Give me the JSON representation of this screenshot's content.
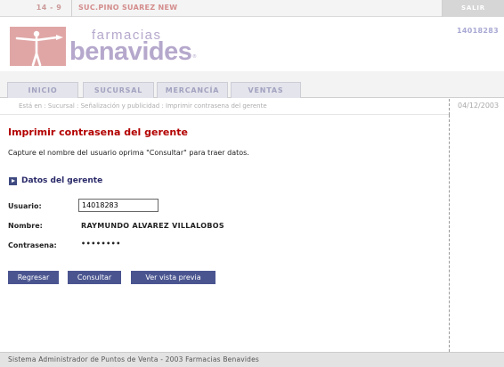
{
  "header": {
    "store_code": "14 - 9",
    "store_name": "SUC.PINO SUAREZ NEW",
    "exit_label": "SALIR",
    "user_code": "14018283"
  },
  "logo": {
    "line1": "farmacias",
    "line2": "benavides",
    "reg": "®"
  },
  "tabs": [
    {
      "label": "INICIO"
    },
    {
      "label": "SUCURSAL"
    },
    {
      "label": "MERCANCÍA"
    },
    {
      "label": "VENTAS"
    }
  ],
  "breadcrumb": "Está en : Sucursal : Señalización y publicidad : Imprimir contrasena del gerente",
  "date": "04/12/2003",
  "page": {
    "title": "Imprimir contrasena del gerente",
    "instructions": "Capture el nombre del usuario oprima \"Consultar\" para traer datos.",
    "section_title": "Datos del gerente"
  },
  "form": {
    "usuario_label": "Usuario:",
    "usuario_value": "14018283",
    "nombre_label": "Nombre:",
    "nombre_value": "RAYMUNDO ALVAREZ VILLALOBOS",
    "contrasena_label": "Contrasena:",
    "contrasena_value": "••••••••"
  },
  "buttons": {
    "back": "Regresar",
    "query": "Consultar",
    "preview": "Ver vista previa"
  },
  "footer": "Sistema Administrador de Puntos de Venta - 2003 Farmacias Benavides",
  "colors": {
    "title_red": "#b30000",
    "button_blue": "#4a5590",
    "logo_lavender": "#b5a8cc"
  }
}
